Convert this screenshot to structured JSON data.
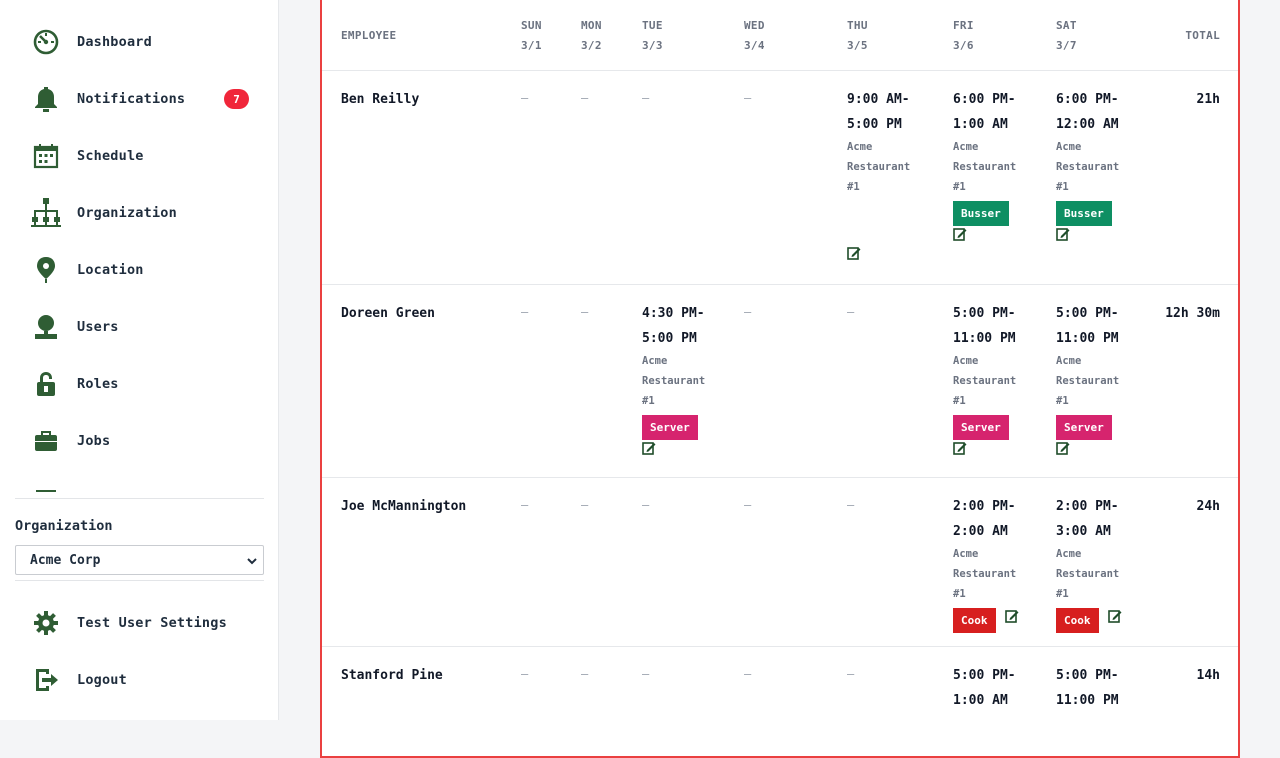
{
  "sidebar": {
    "items": [
      {
        "label": "Dashboard",
        "icon": "dashboard-icon"
      },
      {
        "label": "Notifications",
        "icon": "bell-icon",
        "badge": "7"
      },
      {
        "label": "Schedule",
        "icon": "calendar-icon"
      },
      {
        "label": "Organization",
        "icon": "org-chart-icon"
      },
      {
        "label": "Location",
        "icon": "map-pin-icon"
      },
      {
        "label": "Users",
        "icon": "user-icon"
      },
      {
        "label": "Roles",
        "icon": "unlock-icon"
      },
      {
        "label": "Jobs",
        "icon": "briefcase-icon"
      }
    ],
    "org_label": "Organization",
    "org_value": "Acme Corp",
    "settings_label": "Test User Settings",
    "logout_label": "Logout"
  },
  "schedule": {
    "headers": {
      "employee": "EMPLOYEE",
      "days": [
        {
          "day": "SUN",
          "date": "3/1"
        },
        {
          "day": "MON",
          "date": "3/2"
        },
        {
          "day": "TUE",
          "date": "3/3"
        },
        {
          "day": "WED",
          "date": "3/4"
        },
        {
          "day": "THU",
          "date": "3/5"
        },
        {
          "day": "FRI",
          "date": "3/6"
        },
        {
          "day": "SAT",
          "date": "3/7"
        }
      ],
      "total": "TOTAL"
    },
    "empty_cell": "—",
    "rows": [
      {
        "name": "Ben Reilly",
        "total": "21h",
        "shifts": {
          "thu": {
            "time1": "9:00 AM-",
            "time2": "5:00 PM",
            "loc1": "Acme",
            "loc2": "Restaurant",
            "loc3": "#1",
            "role": ""
          },
          "fri": {
            "time1": "6:00 PM-",
            "time2": "1:00 AM",
            "loc1": "Acme",
            "loc2": "Restaurant",
            "loc3": "#1",
            "role": "Busser"
          },
          "sat": {
            "time1": "6:00 PM-",
            "time2": "12:00 AM",
            "loc1": "Acme",
            "loc2": "Restaurant",
            "loc3": "#1",
            "role": "Busser"
          }
        }
      },
      {
        "name": "Doreen Green",
        "total": "12h 30m",
        "shifts": {
          "tue": {
            "time1": "4:30 PM-",
            "time2": "5:00 PM",
            "loc1": "Acme",
            "loc2": "Restaurant",
            "loc3": "#1",
            "role": "Server"
          },
          "fri": {
            "time1": "5:00 PM-",
            "time2": "11:00 PM",
            "loc1": "Acme",
            "loc2": "Restaurant",
            "loc3": "#1",
            "role": "Server"
          },
          "sat": {
            "time1": "5:00 PM-",
            "time2": "11:00 PM",
            "loc1": "Acme",
            "loc2": "Restaurant",
            "loc3": "#1",
            "role": "Server"
          }
        }
      },
      {
        "name": "Joe McMannington",
        "total": "24h",
        "shifts": {
          "fri": {
            "time1": "2:00 PM-",
            "time2": "2:00 AM",
            "loc1": "Acme",
            "loc2": "Restaurant",
            "loc3": "#1",
            "role": "Cook"
          },
          "sat": {
            "time1": "2:00 PM-",
            "time2": "3:00 AM",
            "loc1": "Acme",
            "loc2": "Restaurant",
            "loc3": "#1",
            "role": "Cook"
          }
        }
      },
      {
        "name": "Stanford Pine",
        "total": "14h",
        "shifts": {
          "fri": {
            "time1": "5:00 PM-",
            "time2": "1:00 AM"
          },
          "sat": {
            "time1": "5:00 PM-",
            "time2": "11:00 PM"
          }
        }
      }
    ]
  },
  "colors": {
    "busser": "#0e8f63",
    "server": "#d6246e",
    "cook": "#d71f1f",
    "badge": "#f0263a",
    "icon_green": "#2f5d34",
    "table_border": "#ea4040"
  }
}
